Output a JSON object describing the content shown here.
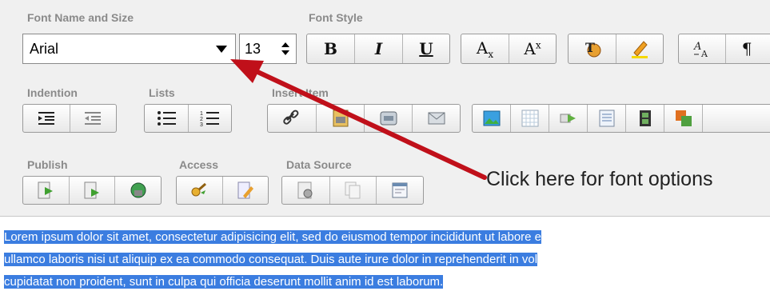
{
  "groups": {
    "font_name_size": "Font Name and Size",
    "font_style": "Font Style",
    "indention": "Indention",
    "lists": "Lists",
    "insert_item": "Insert Item",
    "publish": "Publish",
    "access": "Access",
    "data_source": "Data Source"
  },
  "font": {
    "name": "Arial",
    "size": "13"
  },
  "style_buttons": {
    "bold": "B",
    "italic": "I",
    "underline": "U",
    "subscript": "A",
    "subscript_mark": "x",
    "superscript": "A",
    "superscript_mark": "x",
    "paragraph": "¶"
  },
  "annotation": "Click here for font options",
  "editor": {
    "lines": [
      "Lorem ipsum dolor sit amet, consectetur adipisicing elit, sed do eiusmod tempor incididunt ut labore e",
      "ullamco laboris nisi ut aliquip ex ea commodo consequat. Duis aute irure dolor in reprehenderit in vol",
      "cupidatat non proident, sunt in culpa qui officia deserunt mollit anim id est laborum."
    ]
  },
  "colors": {
    "selection": "#3b7de0",
    "arrow": "#c0101a"
  }
}
